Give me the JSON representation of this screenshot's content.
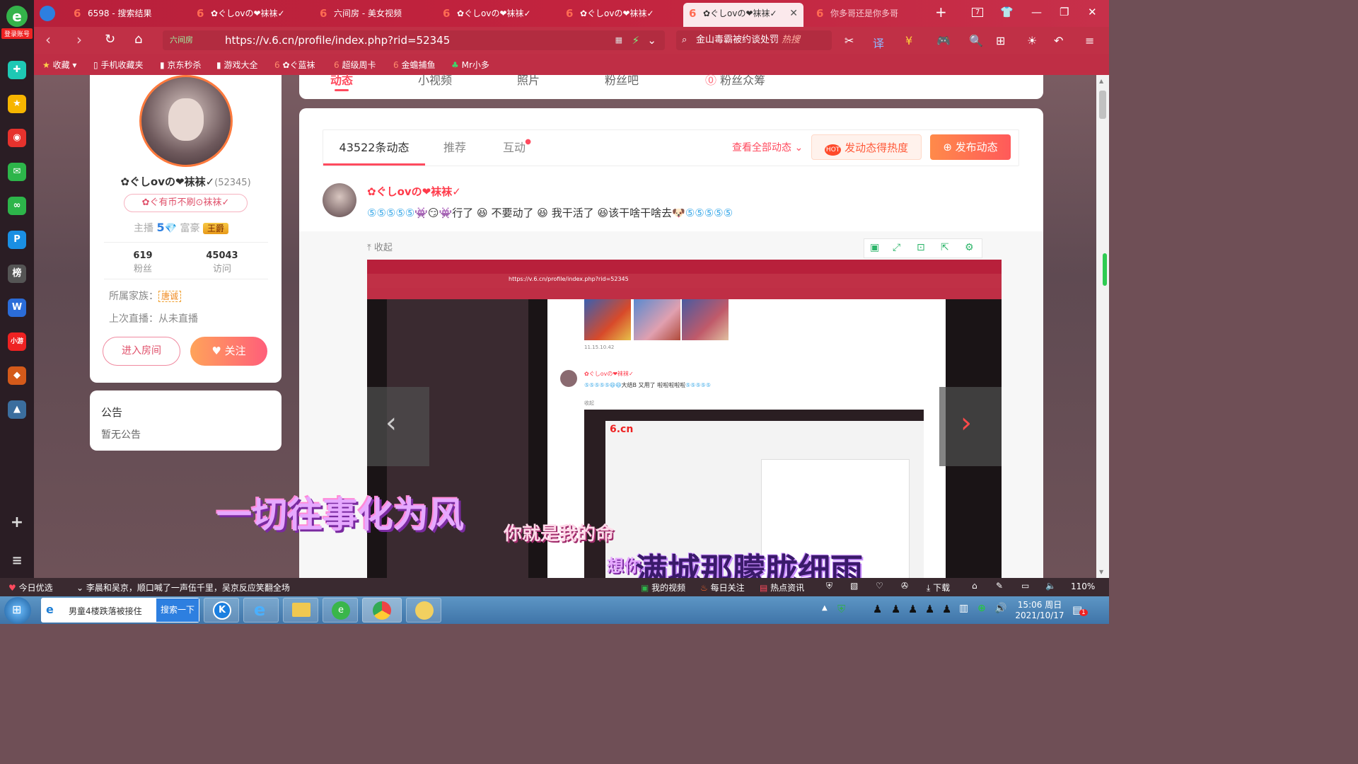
{
  "sidebar": {
    "login_label": "登录账号",
    "logo_letter": "e",
    "items": [
      {
        "icon": "plus-cross-icon",
        "glyph": "✚",
        "color": "#1ec8b4"
      },
      {
        "icon": "star-icon",
        "glyph": "★",
        "color": "#f7b500"
      },
      {
        "icon": "weibo-icon",
        "glyph": "◉",
        "color": "#e6322d"
      },
      {
        "icon": "mail-icon",
        "glyph": "✉",
        "color": "#2db54a"
      },
      {
        "icon": "chain-icon",
        "glyph": "∞",
        "color": "#2db54a"
      },
      {
        "icon": "pay-icon",
        "glyph": "P",
        "color": "#1a8fe3"
      },
      {
        "icon": "ranking-icon",
        "glyph": "榜",
        "color": "#555"
      },
      {
        "icon": "word-icon",
        "glyph": "W",
        "color": "#2b6cd8"
      },
      {
        "icon": "game-icon",
        "glyph": "小游",
        "color": "#e22"
      },
      {
        "icon": "game2-icon",
        "glyph": "◆",
        "color": "#d45a1a"
      },
      {
        "icon": "game3-icon",
        "glyph": "▲",
        "color": "#3b6e9e"
      }
    ],
    "add_glyph": "+",
    "menu_glyph": "≡"
  },
  "tabs": [
    {
      "label": "6598 - 搜索结果"
    },
    {
      "label": "✿ぐしovの❤袜袜✓"
    },
    {
      "label": "六间房 - 美女视频"
    },
    {
      "label": "✿ぐしovの❤袜袜✓"
    },
    {
      "label": "✿ぐしovの❤袜袜✓"
    },
    {
      "label": "✿ぐしovの❤袜袜✓"
    },
    {
      "label": "你多哥还是你多哥"
    }
  ],
  "window": {
    "new_tab": "+",
    "count": "7",
    "min": "—",
    "max": "❐",
    "close": "✕"
  },
  "address": {
    "site_badge": "六间房",
    "url": "https://v.6.cn/profile/index.php?rid=52345",
    "search_text": "金山毒霸被约谈处罚",
    "search_hot": "热搜"
  },
  "bookmarks": [
    {
      "label": "收藏"
    },
    {
      "label": "手机收藏夹"
    },
    {
      "label": "京东秒杀"
    },
    {
      "label": "游戏大全"
    },
    {
      "label": "✿ぐ蓝袜"
    },
    {
      "label": "超级周卡"
    },
    {
      "label": "金蟾捕鱼"
    },
    {
      "label": "Mr小多"
    }
  ],
  "profile_tabs": [
    {
      "label": "动态"
    },
    {
      "label": "小视频"
    },
    {
      "label": "照片"
    },
    {
      "label": "粉丝吧"
    },
    {
      "label": "粉丝众筹"
    }
  ],
  "profile": {
    "name": "✿ぐしovの❤袜袜✓",
    "rid": "(52345)",
    "medal": "✿ぐ有币不刷⊙袜袜✓",
    "anchor_label": "主播",
    "anchor_level": "5",
    "rich_label": "富豪",
    "rich_title": "王爵",
    "fans_count": "619",
    "fans_label": "粉丝",
    "visits_count": "45043",
    "visits_label": "访问",
    "family_label": "所属家族：",
    "family_value": "唐诚",
    "last_live": "上次直播：从未直播",
    "enter_room": "进入房间",
    "follow": "关注"
  },
  "notice": {
    "title": "公告",
    "body": "暂无公告"
  },
  "feed": {
    "tab_count": "43522条动态",
    "tab_recommend": "推荐",
    "tab_interact": "互动",
    "view_all": "查看全部动态",
    "hot_button": "发动态得热度",
    "post_button": "发布动态",
    "post_author": "✿ぐしovの❤袜袜✓",
    "post_text_1": "行了",
    "post_text_2": "不要动了",
    "post_text_3": "我干活了",
    "post_text_4": "该干啥干啥去",
    "collapse": "收起"
  },
  "embedded": {
    "url": "https://v.6.cn/profile/index.php?rid=52345",
    "timestamp": "11.15.10.42",
    "post_author": "✿ぐしovの❤袜袜✓",
    "post_text": "大结B 又用了 啦啦啦啦啦",
    "collapse": "收起",
    "site_logo": "6.cn"
  },
  "lyrics": {
    "line1": "一切往事化为风",
    "line2": "你就是我的命",
    "line3": "满城那朦胧细雨",
    "line3_prefix": "想你"
  },
  "statusbar": {
    "today": "今日优选",
    "news": "李晨和吴京，顺口喊了一声伍千里，吴京反应笑翻全场",
    "my_video": "我的视频",
    "daily": "每日关注",
    "hot_news": "热点资讯",
    "download": "下载",
    "zoom": "110%"
  },
  "taskbar": {
    "ie_news": "男童4楼跌落被接住",
    "search_btn": "搜索一下",
    "time": "15:06 周日",
    "date": "2021/10/17",
    "notify_count": "1"
  }
}
